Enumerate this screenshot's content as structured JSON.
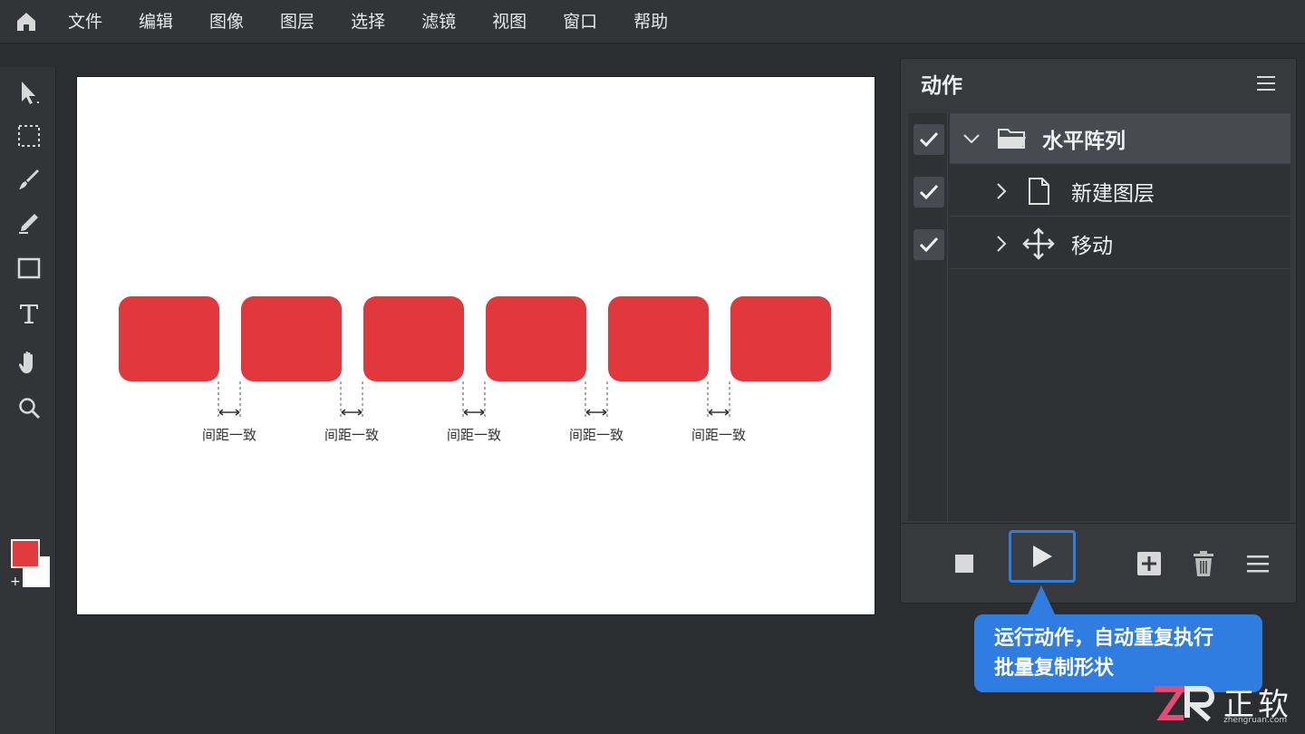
{
  "menubar": {
    "items": [
      "文件",
      "编辑",
      "图像",
      "图层",
      "选择",
      "滤镜",
      "视图",
      "窗口",
      "帮助"
    ]
  },
  "toolbar": {
    "tools": [
      "selection-arrow-icon",
      "marquee-icon",
      "brush-icon",
      "pencil-icon",
      "rectangle-icon",
      "text-icon",
      "hand-icon",
      "zoom-icon"
    ],
    "foreground_color": "#e23b3e",
    "background_color": "#ffffff"
  },
  "canvas": {
    "shape_color": "#e0383c",
    "shape_count": 6,
    "gap_labels": [
      "间距一致",
      "间距一致",
      "间距一致",
      "间距一致",
      "间距一致"
    ]
  },
  "actions_panel": {
    "title": "动作",
    "rows": [
      {
        "label": "水平阵列",
        "icon": "folder-icon",
        "checked": true,
        "expanded": true,
        "selected": true
      },
      {
        "label": "新建图层",
        "icon": "document-icon",
        "checked": true,
        "expanded": false,
        "selected": false
      },
      {
        "label": "移动",
        "icon": "move-icon",
        "checked": true,
        "expanded": false,
        "selected": false
      }
    ]
  },
  "tooltip": {
    "line1": "运行动作，自动重复执行",
    "line2": "批量复制形状"
  },
  "logo": {
    "text": "正软",
    "sub": "zhengruan.com"
  },
  "colors": {
    "accent": "#2f7de1",
    "panel": "#37393d"
  }
}
